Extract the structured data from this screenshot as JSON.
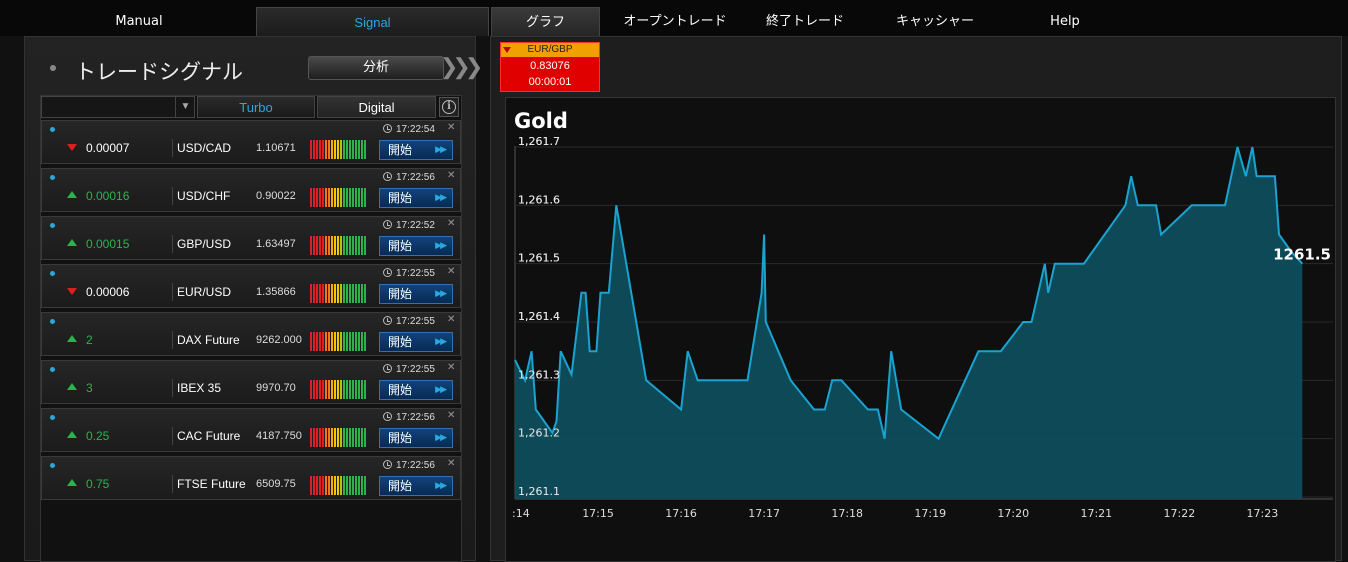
{
  "nav": {
    "manual": "Manual",
    "signal": "Signal",
    "graph": "グラフ",
    "open_trades": "オープントレード",
    "closed_trades": "終了トレード",
    "cashier": "キャッシャー",
    "help": "Help"
  },
  "signals_panel": {
    "title": "トレードシグナル",
    "analysis_button": "分析",
    "tabs": {
      "turbo": "Turbo",
      "digital": "Digital"
    },
    "start_label": "開始",
    "rows": [
      {
        "direction": "down",
        "value": "0.00007",
        "symbol": "USD/CAD",
        "price": "1.10671",
        "time": "17:22:54"
      },
      {
        "direction": "up",
        "value": "0.00016",
        "symbol": "USD/CHF",
        "price": "0.90022",
        "time": "17:22:56"
      },
      {
        "direction": "up",
        "value": "0.00015",
        "symbol": "GBP/USD",
        "price": "1.63497",
        "time": "17:22:52"
      },
      {
        "direction": "down",
        "value": "0.00006",
        "symbol": "EUR/USD",
        "price": "1.35866",
        "time": "17:22:55"
      },
      {
        "direction": "up",
        "value": "2",
        "symbol": "DAX Future",
        "price": "9262.000",
        "time": "17:22:55"
      },
      {
        "direction": "up",
        "value": "3",
        "symbol": "IBEX 35",
        "price": "9970.70",
        "time": "17:22:55"
      },
      {
        "direction": "up",
        "value": "0.25",
        "symbol": "CAC Future",
        "price": "4187.750",
        "time": "17:22:56"
      },
      {
        "direction": "up",
        "value": "0.75",
        "symbol": "FTSE Future",
        "price": "6509.75",
        "time": "17:22:56"
      }
    ]
  },
  "asset_tab": {
    "symbol": "EUR/GBP",
    "price": "0.83076",
    "timer": "00:00:01"
  },
  "chart_data": {
    "type": "area",
    "title": "Gold",
    "current_value_label": "1261.5",
    "xlabel": "",
    "ylabel": "",
    "y_ticks": [
      "1,261.1",
      "1,261.2",
      "1,261.3",
      "1,261.4",
      "1,261.5",
      "1,261.6",
      "1,261.7"
    ],
    "x_ticks": [
      ":14",
      "17:15",
      "17:16",
      "17:17",
      "17:18",
      "17:19",
      "17:20",
      "17:21",
      "17:22",
      "17:23"
    ],
    "x_range_min": [
      14.0,
      23.85
    ],
    "ylim": [
      1261.1,
      1261.7
    ],
    "color": "#1aa3d1",
    "fill": "#0e4d5c",
    "points": [
      [
        14.0,
        1261.335
      ],
      [
        14.12,
        1261.3
      ],
      [
        14.2,
        1261.35
      ],
      [
        14.25,
        1261.25
      ],
      [
        14.45,
        1261.21
      ],
      [
        14.5,
        1261.23
      ],
      [
        14.55,
        1261.35
      ],
      [
        14.68,
        1261.31
      ],
      [
        14.8,
        1261.45
      ],
      [
        14.85,
        1261.45
      ],
      [
        14.9,
        1261.35
      ],
      [
        14.98,
        1261.35
      ],
      [
        15.03,
        1261.45
      ],
      [
        15.13,
        1261.45
      ],
      [
        15.22,
        1261.6
      ],
      [
        15.58,
        1261.3
      ],
      [
        16.0,
        1261.25
      ],
      [
        16.08,
        1261.35
      ],
      [
        16.2,
        1261.3
      ],
      [
        16.8,
        1261.3
      ],
      [
        16.97,
        1261.45
      ],
      [
        17.0,
        1261.55
      ],
      [
        17.02,
        1261.4
      ],
      [
        17.32,
        1261.3
      ],
      [
        17.6,
        1261.25
      ],
      [
        17.73,
        1261.25
      ],
      [
        17.82,
        1261.3
      ],
      [
        17.93,
        1261.3
      ],
      [
        18.25,
        1261.25
      ],
      [
        18.37,
        1261.25
      ],
      [
        18.45,
        1261.2
      ],
      [
        18.53,
        1261.35
      ],
      [
        18.65,
        1261.25
      ],
      [
        19.1,
        1261.2
      ],
      [
        19.58,
        1261.35
      ],
      [
        19.85,
        1261.35
      ],
      [
        20.12,
        1261.4
      ],
      [
        20.22,
        1261.4
      ],
      [
        20.3,
        1261.45
      ],
      [
        20.38,
        1261.5
      ],
      [
        20.42,
        1261.45
      ],
      [
        20.5,
        1261.5
      ],
      [
        20.85,
        1261.5
      ],
      [
        21.35,
        1261.6
      ],
      [
        21.42,
        1261.65
      ],
      [
        21.5,
        1261.6
      ],
      [
        21.72,
        1261.6
      ],
      [
        21.78,
        1261.55
      ],
      [
        22.15,
        1261.6
      ],
      [
        22.55,
        1261.6
      ],
      [
        22.7,
        1261.7
      ],
      [
        22.8,
        1261.65
      ],
      [
        22.88,
        1261.7
      ],
      [
        22.93,
        1261.65
      ],
      [
        23.15,
        1261.65
      ],
      [
        23.2,
        1261.55
      ],
      [
        23.35,
        1261.52
      ],
      [
        23.48,
        1261.5
      ]
    ]
  }
}
